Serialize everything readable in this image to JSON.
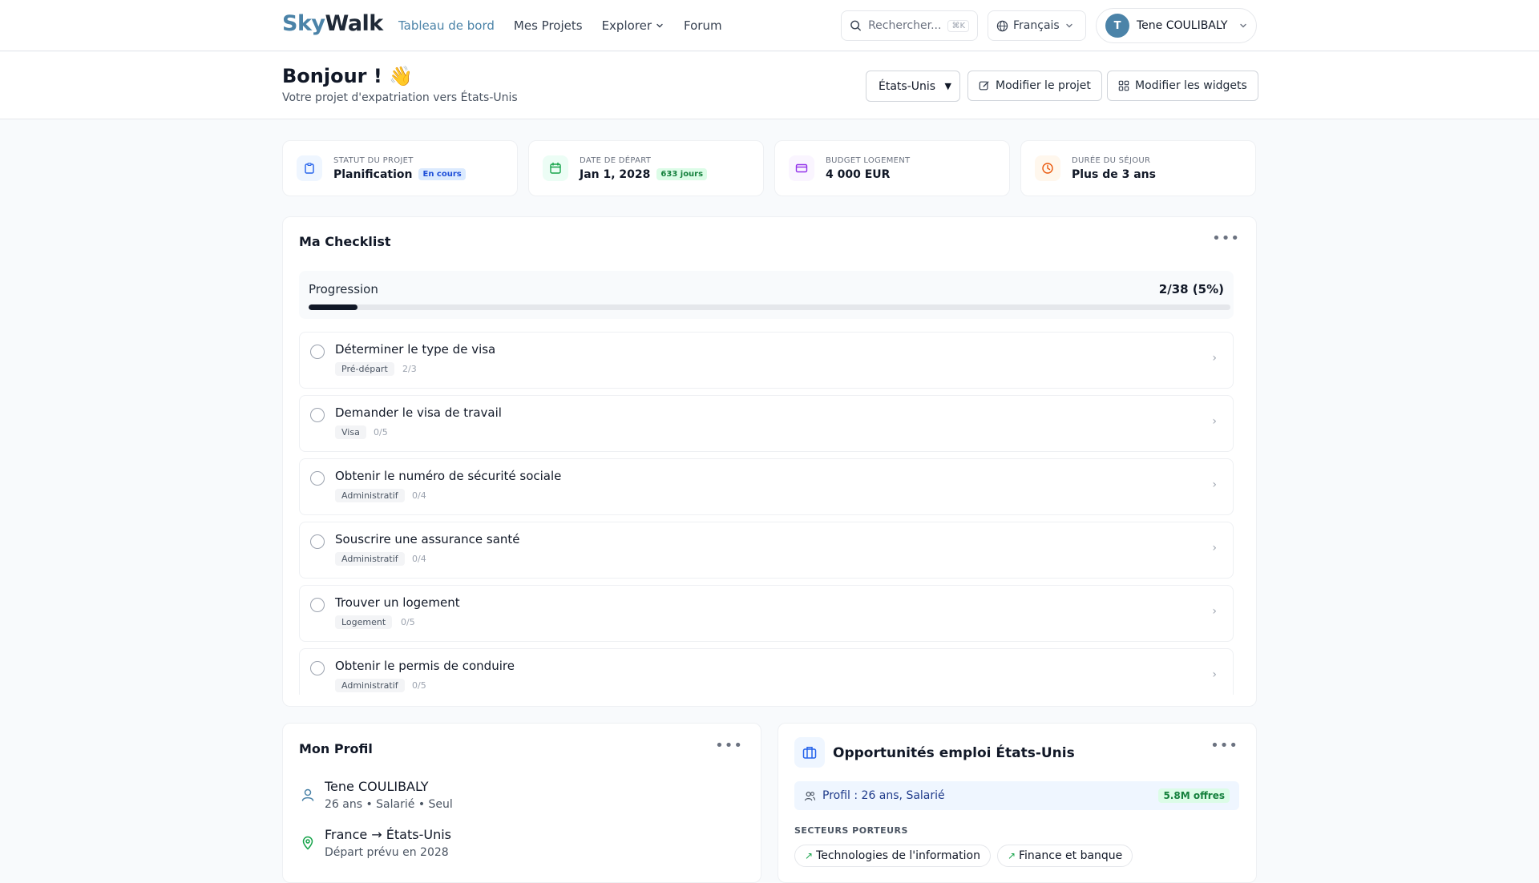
{
  "brand": {
    "part1": "Sky",
    "part2": "Walk"
  },
  "nav": {
    "items": [
      {
        "label": "Tableau de bord"
      },
      {
        "label": "Mes Projets"
      },
      {
        "label": "Explorer"
      },
      {
        "label": "Forum"
      }
    ]
  },
  "search": {
    "placeholder": "Rechercher...",
    "shortcut": "⌘K"
  },
  "language": {
    "label": "Français"
  },
  "user": {
    "initial": "T",
    "name": "Tene COULIBALY"
  },
  "header": {
    "greeting": "Bonjour ! 👋",
    "subtitle": "Votre projet d'expatriation vers États-Unis",
    "country_selected": "États-Unis",
    "edit_project": "Modifier le projet",
    "edit_widgets": "Modifier les widgets"
  },
  "stats": [
    {
      "label": "Statut du projet",
      "value": "Planification",
      "badge": "En cours"
    },
    {
      "label": "Date de départ",
      "value": "Jan 1, 2028",
      "badge": "633 jours"
    },
    {
      "label": "Budget logement",
      "value": "4 000 EUR"
    },
    {
      "label": "Durée du séjour",
      "value": "Plus de 3 ans"
    }
  ],
  "checklist": {
    "title": "Ma Checklist",
    "progress_label": "Progression",
    "progress_text": "2/38 (5%)",
    "progress_fraction": 0.053,
    "tasks": [
      {
        "title": "Déterminer le type de visa",
        "tag": "Pré-départ",
        "count": "2/3"
      },
      {
        "title": "Demander le visa de travail",
        "tag": "Visa",
        "count": "0/5"
      },
      {
        "title": "Obtenir le numéro de sécurité sociale",
        "tag": "Administratif",
        "count": "0/4"
      },
      {
        "title": "Souscrire une assurance santé",
        "tag": "Administratif",
        "count": "0/4"
      },
      {
        "title": "Trouver un logement",
        "tag": "Logement",
        "count": "0/5"
      },
      {
        "title": "Obtenir le permis de conduire",
        "tag": "Administratif",
        "count": "0/5"
      }
    ]
  },
  "profile": {
    "title": "Mon Profil",
    "name": "Tene COULIBALY",
    "details": "26 ans • Salarié • Seul",
    "route": "France → États-Unis",
    "departure": "Départ prévu en 2028"
  },
  "jobs": {
    "title": "Opportunités emploi États-Unis",
    "profile_text": "Profil : 26 ans, Salarié",
    "offers": "5.8M offres",
    "sectors_label": "Secteurs porteurs",
    "sectors": [
      "Technologies de l'information",
      "Finance et banque"
    ]
  },
  "colors": {
    "accent": "#4b83a8",
    "dark": "#111827",
    "green": "#16a34a"
  }
}
